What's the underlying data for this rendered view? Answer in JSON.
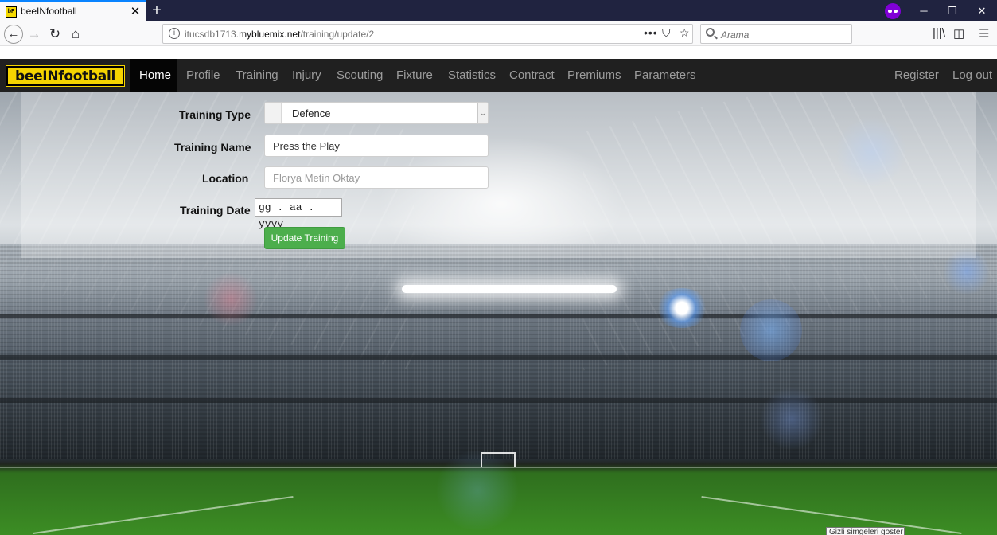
{
  "browser": {
    "tab_title": "beeINfootball",
    "tab_favicon_text": "bF",
    "url_prefix": "itucsdb1713.",
    "url_host": "mybluemix.net",
    "url_path": "/training/update/2",
    "search_placeholder": "Arama",
    "icons": [
      "back-arrow-icon",
      "forward-arrow-icon",
      "reload-icon",
      "home-icon",
      "info-icon",
      "page-actions-icon",
      "pocket-icon",
      "bookmark-star-icon",
      "search-icon",
      "library-icon",
      "sidebar-icon",
      "hamburger-menu-icon",
      "private-mask-icon",
      "minimize-icon",
      "restore-icon",
      "close-icon"
    ]
  },
  "site": {
    "brand": "beeINfootball",
    "nav": {
      "home": "Home",
      "profile": "Profile",
      "training": "Training",
      "injury": "Injury",
      "scouting": "Scouting",
      "fixture": "Fixture",
      "statistics": "Statistics",
      "contract": "Contract",
      "premiums": "Premiums",
      "parameters": "Parameters",
      "register": "Register",
      "logout": "Log out"
    }
  },
  "form": {
    "training_type_label": "Training Type",
    "training_type_value": "Defence",
    "training_name_label": "Training Name",
    "training_name_value": "Press the Play",
    "location_label": "Location",
    "location_placeholder": "Florya Metin Oktay",
    "training_date_label": "Training Date",
    "training_date_placeholder": "gg . aa . yyyy",
    "submit_label": "Update Training"
  },
  "taskbar_tooltip": "Gizli simgeleri göster",
  "colors": {
    "brand_yellow": "#f5d400",
    "navbar_bg": "#202020",
    "button_green": "#4cae4c",
    "browser_frame": "#202340"
  }
}
